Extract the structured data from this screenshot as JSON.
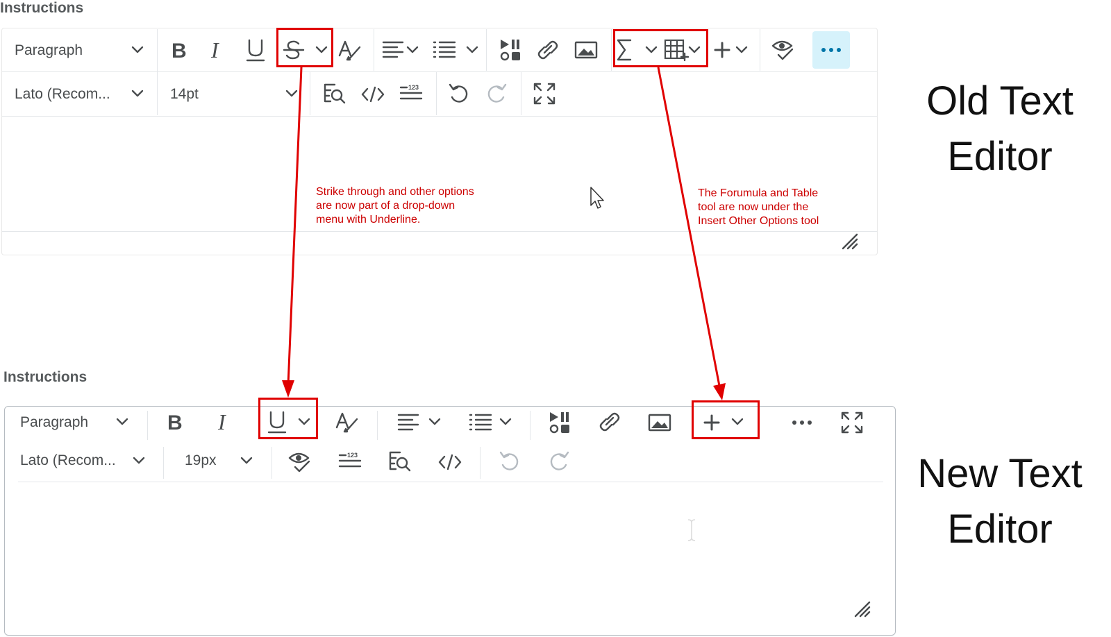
{
  "old_editor": {
    "label": "Instructions",
    "block_format": "Paragraph",
    "font_family": "Lato (Recom...",
    "font_size": "14pt"
  },
  "new_editor": {
    "label": "Instructions",
    "block_format": "Paragraph",
    "font_family": "Lato (Recom...",
    "font_size": "19px"
  },
  "annotations": {
    "strike_note": "Strike through and other options are now part of a drop-down menu with Underline.",
    "insert_note": "The Forumula and Table tool are now under the Insert Other Options tool",
    "old_title": "Old Text Editor",
    "new_title": "New Text Editor"
  },
  "colors": {
    "annotation_red": "#e00000",
    "more_active_bg": "#d6f2fb",
    "more_active_icon": "#0075a8"
  },
  "icons": [
    "bold-icon",
    "italic-icon",
    "underline-icon",
    "strikethrough-icon",
    "format-painter-icon",
    "align-icon",
    "list-icon",
    "media-icon",
    "link-icon",
    "image-icon",
    "formula-icon",
    "table-icon",
    "plus-icon",
    "preview-icon",
    "more-icon",
    "find-replace-icon",
    "code-icon",
    "word-count-icon",
    "undo-icon",
    "redo-icon",
    "fullscreen-icon",
    "resize-handle-icon",
    "mouse-cursor-icon",
    "text-cursor-icon"
  ]
}
